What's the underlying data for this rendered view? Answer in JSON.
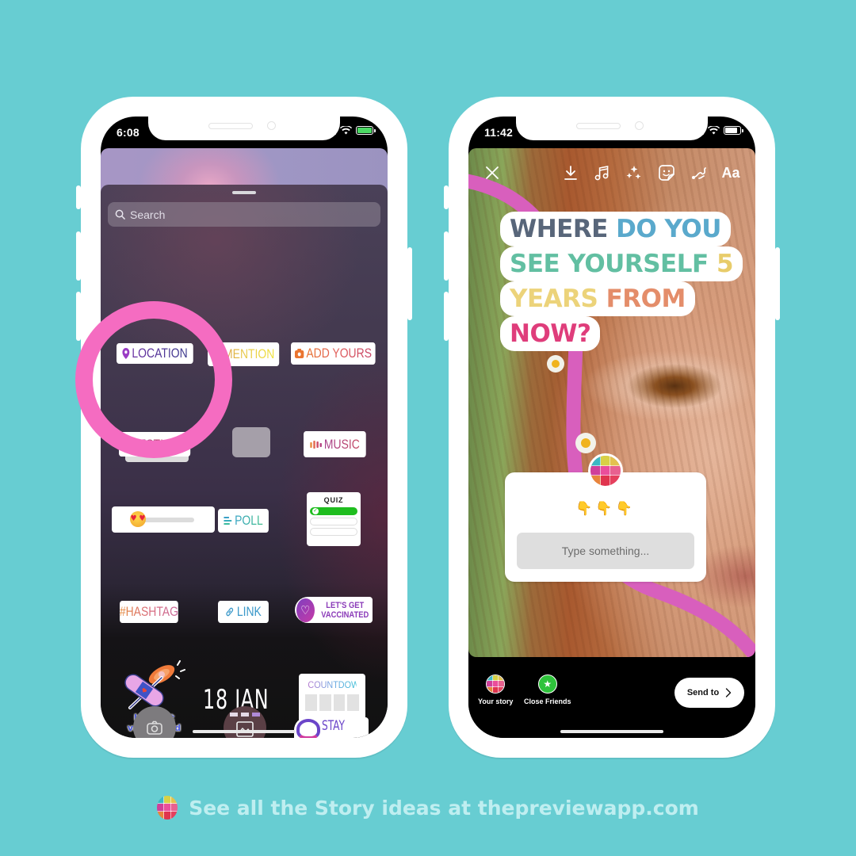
{
  "left_phone": {
    "status": {
      "time": "6:08",
      "battery": "charging"
    },
    "search": {
      "placeholder": "Search"
    },
    "stickers": {
      "location": "LOCATION",
      "mention": "@MENTION",
      "add_yours": "ADD YOURS",
      "questions": "QUESTIONS",
      "music": "MUSIC",
      "emoji_slider": {
        "emoji": "😍",
        "value_fraction": 0.2
      },
      "poll": "POLL",
      "quiz": {
        "title": "QUIZ",
        "options": 3,
        "correct_index": 0
      },
      "hashtag": "#HASHTAG",
      "link": "LINK",
      "vaccinated_badge": [
        "LET'S GET",
        "VACCINATED"
      ],
      "vaccinated_sticker": [
        "let's get",
        "vaccinated"
      ],
      "date": "18 JAN",
      "countdown": "COUNTDOWN",
      "stay_home": "STAY"
    },
    "highlight": {
      "target": "questions",
      "color": "#f56cc1"
    }
  },
  "right_phone": {
    "status": {
      "time": "11:42"
    },
    "toolbar": {
      "close": "close-icon",
      "tools": [
        "download-icon",
        "music-icon",
        "effects-icon",
        "sticker-icon",
        "draw-icon"
      ],
      "text_tool": "Aa"
    },
    "question_lines": [
      [
        {
          "text": "WHERE ",
          "color": "#58667a"
        },
        {
          "text": "DO YOU",
          "color": "#5aa9cc"
        }
      ],
      [
        {
          "text": "SEE YOURSELF ",
          "color": "#62bfa2"
        },
        {
          "text": "5",
          "color": "#e8cc6a"
        }
      ],
      [
        {
          "text": "YEARS ",
          "color": "#ecd37a"
        },
        {
          "text": "FROM",
          "color": "#e48d6a"
        }
      ],
      [
        {
          "text": "NOW?",
          "color": "#df3d7b"
        }
      ]
    ],
    "question_sticker": {
      "emojis": "👇👇👇",
      "placeholder": "Type something..."
    },
    "share": {
      "your_story": "Your story",
      "close_friends": "Close Friends",
      "send_to": "Send to"
    }
  },
  "avatar_colors": [
    "#3bb8c4",
    "#d8d146",
    "#e3c24f",
    "#cf3f9a",
    "#ea4e9b",
    "#e86190",
    "#e8843c",
    "#e0344e",
    "#e5405e"
  ],
  "footer": {
    "text": "See all the Story ideas at thepreviewapp.com"
  }
}
